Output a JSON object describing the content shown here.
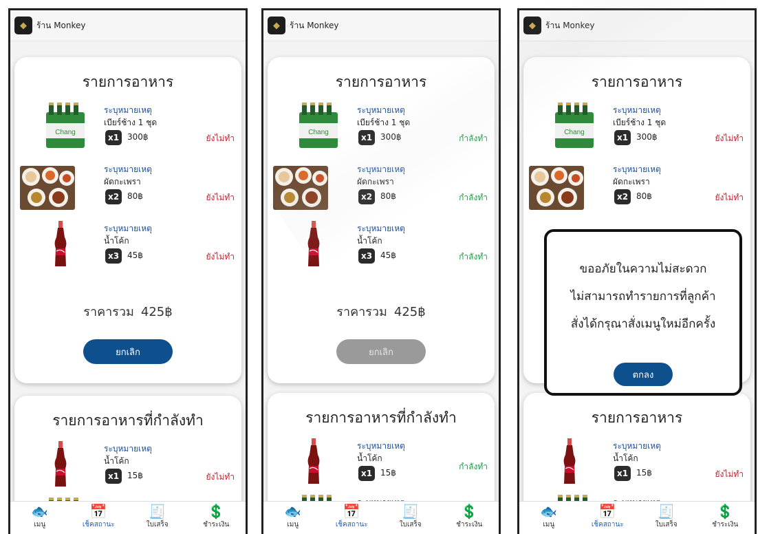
{
  "shop": {
    "name": "ร้าน Monkey"
  },
  "labels": {
    "card_title": "รายการอาหาร",
    "card_title_cooking": "รายการอาหารที่กำลังทำ",
    "note": "ระบุหมายเหตุ",
    "total_label": "ราคารวม",
    "total_amount": "425฿",
    "cancel": "ยกเลิก"
  },
  "items": [
    {
      "name": "เบียร์ช้าง 1 ชุด",
      "qty": "x1",
      "price": "300฿",
      "image": "beer-pack"
    },
    {
      "name": "ผัดกะเพรา",
      "qty": "x2",
      "price": "80฿",
      "image": "thai-dishes"
    },
    {
      "name": "น้ำโค้ก",
      "qty": "x3",
      "price": "45฿",
      "image": "coke-bottle"
    }
  ],
  "second_item": {
    "name": "น้ำโค้ก",
    "qty": "x1",
    "price": "15฿"
  },
  "statuses": {
    "not_done": "ยังไม่ทำ",
    "cooking": "กำลังทำ"
  },
  "status_colors": {
    "not_done": "#c0202a",
    "cooking": "#18a043"
  },
  "dialog": {
    "line1": "ขออภัยในความไม่สะดวก",
    "line2": "ไม่สามารถทำรายการที่ลูกค้า",
    "line3": "สั่งได้กรุณาสั่งเมนูใหม่อีกครั้ง",
    "ok": "ตกลง"
  },
  "nav": [
    {
      "label": "เมนู",
      "icon": "fish-icon"
    },
    {
      "label": "เช็คสถานะ",
      "icon": "calendar-star-icon"
    },
    {
      "label": "ใบเสร็จ",
      "icon": "receipt-icon"
    },
    {
      "label": "ชำระเงิน",
      "icon": "payment-hand-icon"
    }
  ],
  "accent": "#0e4f8e"
}
